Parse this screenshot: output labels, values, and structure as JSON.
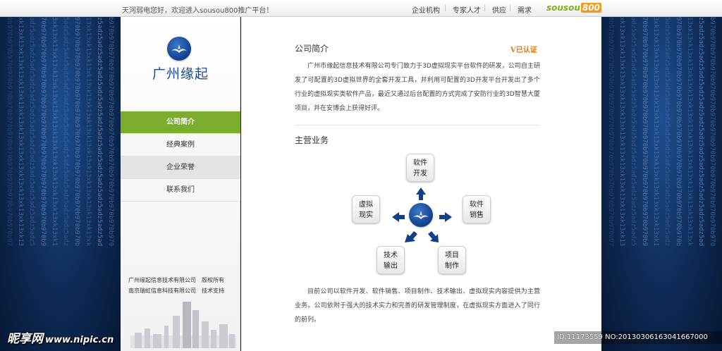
{
  "topbar": {
    "welcome": "天河弱电您好，欢迎进入sousou800推广平台！",
    "nav": [
      "企业机构",
      "专家人才",
      "供应",
      "需求"
    ],
    "brand_a": "sousou",
    "brand_b": "800"
  },
  "sidebar": {
    "logo_text": "广州缘起",
    "menu": [
      "公司简介",
      "经典案例",
      "企业荣誉",
      "联系我们"
    ],
    "copyright_rows": [
      [
        "广州缘起信息技术有限公司",
        "版权所有"
      ],
      [
        "南京瑞虹信息科技有限公司",
        "技术支持"
      ]
    ]
  },
  "main": {
    "intro_title": "公司简介",
    "verified": "V已认证",
    "intro_text": "广州市缘起信息技术有限公司专门致力于3D虚拟现实平台软件的研发，公司自主研发了可配置的3D虚拟世界的全套开发工具，并利用可配置的3D开发平台开发出了多个行业的虚拟现实类软件产品，最近又通过后台配置的方式完成了安防行业的3D智慧大厦项目，并在安博会上获得好评。",
    "business_title": "主营业务",
    "business_items": [
      [
        "软件",
        "开发"
      ],
      [
        "软件",
        "销售"
      ],
      [
        "项目",
        "制作"
      ],
      [
        "技术",
        "输出"
      ],
      [
        "虚拟",
        "现实"
      ]
    ],
    "business_text": "目前公司以软件开发、软件销售、项目制作、技术输出、虚拟现实内容提供为主营业务。公司依附于强大的技术实力和完善的研发管理制度，在虚拟现实方面进入了同行的前列。"
  },
  "watermark": {
    "site": "昵享网",
    "url": "www.nipic.cn",
    "id_text": "ID:11173559 NO:20130306163041667000"
  },
  "colors": {
    "accent_green": "#7cad2c",
    "brand_blue": "#1a4a9a",
    "arrow_blue": "#0f3f8c",
    "verified_orange": "#e07b14"
  }
}
